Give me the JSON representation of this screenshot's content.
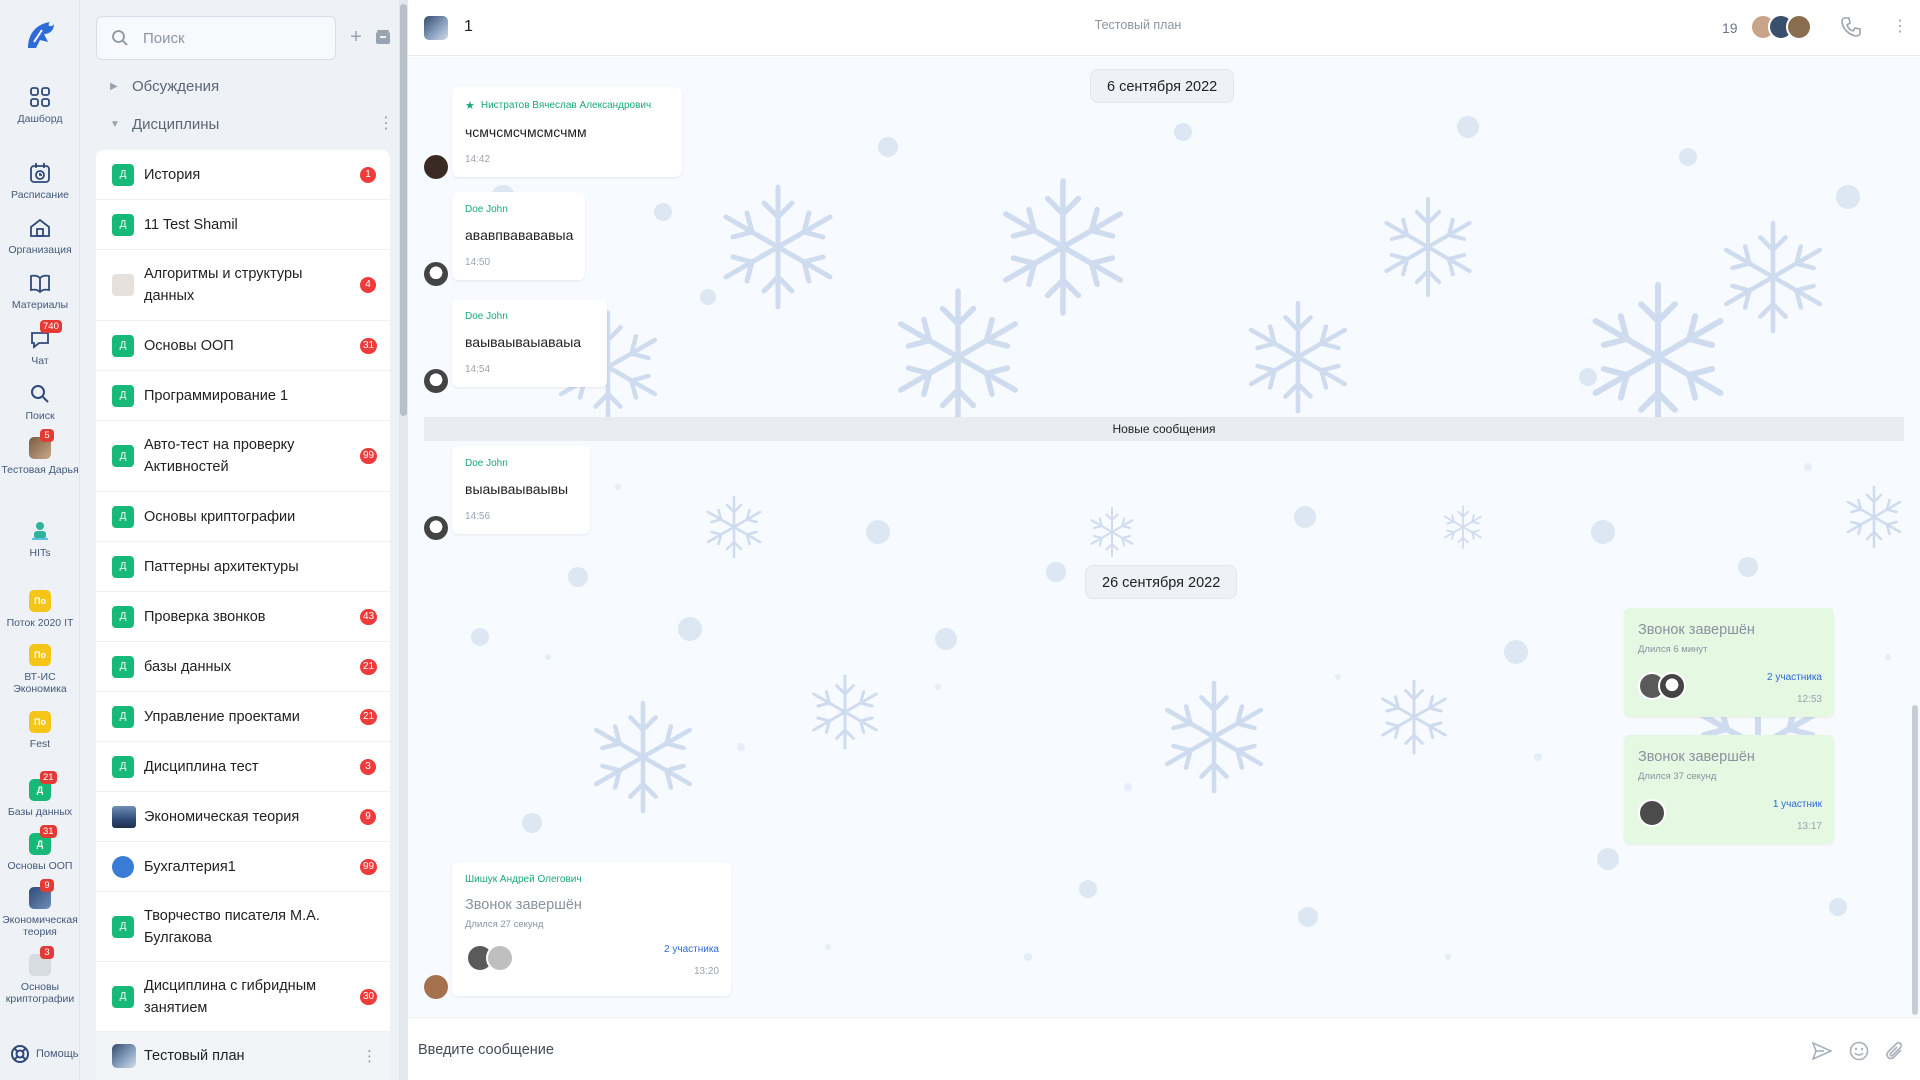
{
  "rail": {
    "logo": "spartan-helmet-logo",
    "items": [
      {
        "label": "Дашборд",
        "icon": "dashboard-icon"
      },
      {
        "label": "Расписание",
        "icon": "calendar-icon"
      },
      {
        "label": "Организация",
        "icon": "home-icon"
      },
      {
        "label": "Материалы",
        "icon": "book-icon"
      },
      {
        "label": "Чат",
        "icon": "chat-icon",
        "badge": "740"
      },
      {
        "label": "Поиск",
        "icon": "search-icon"
      },
      {
        "label": "Тестовая Дарья",
        "icon": "avatar",
        "badge": "5"
      },
      {
        "label": "HITs",
        "icon": "avatar"
      },
      {
        "label": "Поток 2020 IT",
        "icon": "По"
      },
      {
        "label": "ВТ-ИС Экономика",
        "icon": "По"
      },
      {
        "label": "Fest",
        "icon": "По"
      },
      {
        "label": "Базы данных",
        "icon": "Д",
        "badge": "21"
      },
      {
        "label": "Основы ООП",
        "icon": "Д",
        "badge": "31"
      },
      {
        "label": "Экономическая теория",
        "icon": "avatar",
        "badge": "9"
      },
      {
        "label": "Основы криптографии",
        "icon": "avatar",
        "badge": "3"
      }
    ],
    "help_label": "Помощь"
  },
  "panel": {
    "search_placeholder": "Поиск",
    "groups": {
      "discussions": "Обсуждения",
      "disciplines": "Дисциплины"
    },
    "items": [
      {
        "label": "История",
        "avatar": "Д",
        "badge": "1"
      },
      {
        "label": "11 Test Shamil",
        "avatar": "Д",
        "badge": ""
      },
      {
        "label": "Алгоритмы и структуры данных",
        "avatar": "img",
        "badge": "4"
      },
      {
        "label": "Основы ООП",
        "avatar": "Д",
        "badge": "31"
      },
      {
        "label": "Программирование 1",
        "avatar": "Д",
        "badge": ""
      },
      {
        "label": "Авто-тест на проверку Активностей",
        "avatar": "Д",
        "badge": "99"
      },
      {
        "label": "Основы криптографии",
        "avatar": "Д",
        "badge": ""
      },
      {
        "label": "Паттерны архитектуры",
        "avatar": "Д",
        "badge": ""
      },
      {
        "label": "Проверка звонков",
        "avatar": "Д",
        "badge": "43"
      },
      {
        "label": "базы данных",
        "avatar": "Д",
        "badge": "21"
      },
      {
        "label": "Управление проектами",
        "avatar": "Д",
        "badge": "21"
      },
      {
        "label": "Дисциплина тест",
        "avatar": "Д",
        "badge": "3"
      },
      {
        "label": "Экономическая теория",
        "avatar": "img",
        "badge": "9"
      },
      {
        "label": "Бухгалтерия1",
        "avatar": "img",
        "badge": "99"
      },
      {
        "label": "Творчество писателя М.А. Булгакова",
        "avatar": "Д",
        "badge": ""
      },
      {
        "label": "Дисциплина с гибридным занятием",
        "avatar": "Д",
        "badge": "30"
      },
      {
        "label": "Тестовый план",
        "avatar": "img",
        "badge": ""
      }
    ]
  },
  "chat": {
    "title": "1",
    "subtitle": "Тестовый план",
    "member_count": "19",
    "date1": "6 сентября 2022",
    "date2": "26 сентября 2022",
    "new_messages": "Новые сообщения",
    "messages": [
      {
        "author": "Нистратов Вячеслав Александрович",
        "text": "чсмчсмсчмсмсчмм",
        "time": "14:42"
      },
      {
        "author": "Doe John",
        "text": "ававпвавававыа",
        "time": "14:50"
      },
      {
        "author": "Doe John",
        "text": "ваываываыаваыа",
        "time": "14:54"
      },
      {
        "author": "Doe John",
        "text": "выаываываывы",
        "time": "14:56"
      }
    ],
    "calls": [
      {
        "title": "Звонок завершён",
        "duration": "Длился 6 минут",
        "participants": "2 участника",
        "time": "12:53"
      },
      {
        "title": "Звонок завершён",
        "duration": "Длился 37 секунд",
        "participants": "1 участник",
        "time": "13:17"
      },
      {
        "author": "Шишук Андрей Олегович",
        "title": "Звонок завершён",
        "duration": "Длился 27 секунд",
        "participants": "2 участника",
        "time": "13:20"
      }
    ],
    "input_placeholder": "Введите сообщение"
  },
  "colors": {
    "accent_green": "#19a974",
    "badge_red": "#ef3b3b",
    "call_bg": "#e4f8e2",
    "rail_bg": "#eef2f7"
  }
}
